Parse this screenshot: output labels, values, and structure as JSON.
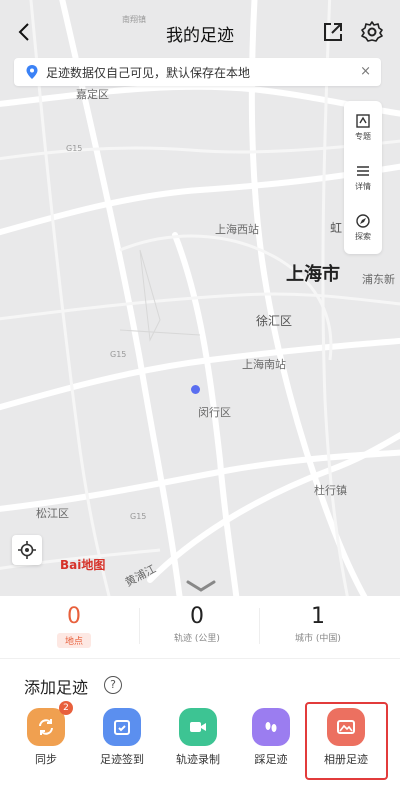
{
  "header": {
    "title": "我的足迹",
    "back_icon": "back-arrow-icon",
    "share_icon": "share-icon",
    "settings_icon": "gear-icon"
  },
  "notice": {
    "text": "足迹数据仅自己可见，默认保存在本地",
    "close": "×"
  },
  "map": {
    "labels": {
      "jiading": "嘉定区",
      "shanghai_west": "上海西站",
      "shanghai_city": "上海市",
      "xuhui": "徐汇区",
      "shanghai_south": "上海南站",
      "minhang": "闵行区",
      "songjiang": "松江区",
      "huangpu_river": "黄浦江",
      "zhuqiao": "杜行镇",
      "pudong": "浦东新",
      "hongqiao": "虹",
      "top_town": "南翔镇",
      "g15_a": "G15",
      "g15_b": "G15",
      "g15_c": "G15"
    },
    "logo": "Bai地图"
  },
  "tools": [
    {
      "label": "专题",
      "icon": "topic-icon"
    },
    {
      "label": "详情",
      "icon": "list-icon"
    },
    {
      "label": "探索",
      "icon": "explore-icon"
    }
  ],
  "stats": [
    {
      "value": "0",
      "label": "地点",
      "active": true
    },
    {
      "value": "0",
      "label": "轨迹 (公里)"
    },
    {
      "value": "1",
      "label": "城市 (中国)"
    }
  ],
  "add_section": {
    "title": "添加足迹",
    "help": "?"
  },
  "actions": [
    {
      "label": "同步",
      "icon": "sync-icon",
      "color": "#f0a050",
      "badge": "2"
    },
    {
      "label": "足迹签到",
      "icon": "checkin-icon",
      "color": "#5b8fef"
    },
    {
      "label": "轨迹录制",
      "icon": "video-record-icon",
      "color": "#3dc493"
    },
    {
      "label": "踩足迹",
      "icon": "footprint-icon",
      "color": "#9b7df0"
    },
    {
      "label": "相册足迹",
      "icon": "photo-album-icon",
      "color": "#ec7060"
    }
  ]
}
